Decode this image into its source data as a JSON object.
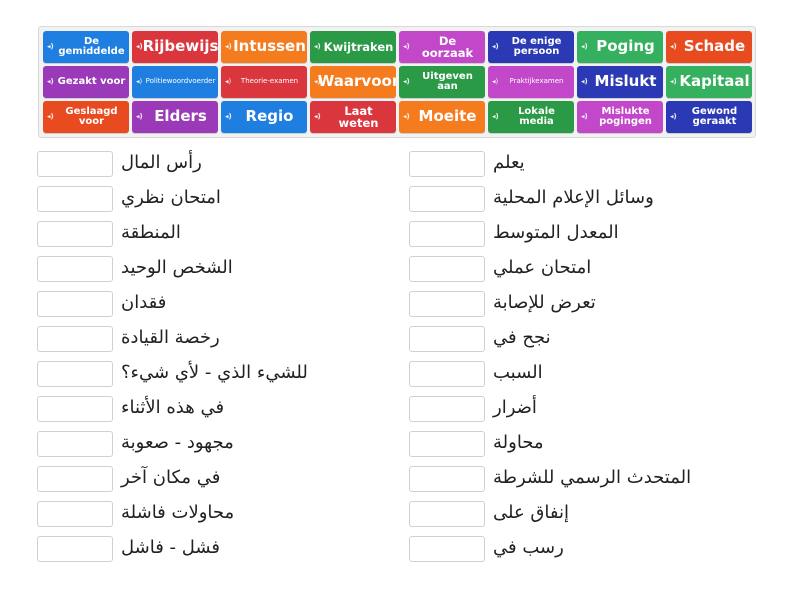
{
  "tiles": [
    {
      "label": "De gemiddelde",
      "color": "#1f7fe0",
      "size": "sz-s"
    },
    {
      "label": "Rijbewijs",
      "color": "#d9363e",
      "size": "sz-l"
    },
    {
      "label": "Intussen",
      "color": "#f47c1f",
      "size": "sz-l"
    },
    {
      "label": "Kwijtraken",
      "color": "#2b9a47",
      "size": "sz-m"
    },
    {
      "label": "De oorzaak",
      "color": "#c348c9",
      "size": "sz-m"
    },
    {
      "label": "De enige persoon",
      "color": "#2b3ab4",
      "size": "sz-s"
    },
    {
      "label": "Poging",
      "color": "#34b05e",
      "size": "sz-l"
    },
    {
      "label": "Schade",
      "color": "#e84b1f",
      "size": "sz-l"
    },
    {
      "label": "Gezakt voor",
      "color": "#9b3ab8",
      "size": "sz-s"
    },
    {
      "label": "Politiewoordvoerder",
      "color": "#1f7fe0",
      "size": "sz-xs"
    },
    {
      "label": "Theorie-examen",
      "color": "#d9363e",
      "size": "sz-xs"
    },
    {
      "label": "Waarvoor",
      "color": "#f47c1f",
      "size": "sz-l"
    },
    {
      "label": "Uitgeven aan",
      "color": "#2b9a47",
      "size": "sz-s"
    },
    {
      "label": "Praktijkexamen",
      "color": "#c348c9",
      "size": "sz-xs"
    },
    {
      "label": "Mislukt",
      "color": "#2b3ab4",
      "size": "sz-l"
    },
    {
      "label": "Kapitaal",
      "color": "#34b05e",
      "size": "sz-l"
    },
    {
      "label": "Geslaagd voor",
      "color": "#e84b1f",
      "size": "sz-s"
    },
    {
      "label": "Elders",
      "color": "#9b3ab8",
      "size": "sz-l"
    },
    {
      "label": "Regio",
      "color": "#1f7fe0",
      "size": "sz-l"
    },
    {
      "label": "Laat weten",
      "color": "#d9363e",
      "size": "sz-m"
    },
    {
      "label": "Moeite",
      "color": "#f47c1f",
      "size": "sz-l"
    },
    {
      "label": "Lokale media",
      "color": "#2b9a47",
      "size": "sz-s"
    },
    {
      "label": "Mislukte pogingen",
      "color": "#c348c9",
      "size": "sz-s"
    },
    {
      "label": "Gewond geraakt",
      "color": "#2b3ab4",
      "size": "sz-s"
    }
  ],
  "left_column": [
    "رأس المال",
    "امتحان نظري",
    "المنطقة",
    "الشخص الوحيد",
    "فقدان",
    "رخصة القيادة",
    "للشيء الذي - لأي شيء؟",
    "في هذه الأثناء",
    "مجهود - صعوبة",
    "في مكان آخر",
    "محاولات فاشلة",
    "فشل - فاشل"
  ],
  "right_column": [
    "يعلم",
    "وسائل الإعلام المحلية",
    "المعدل المتوسط",
    "امتحان عملي",
    "تعرض للإصابة",
    "نجح في",
    "السبب",
    "أضرار",
    "محاولة",
    "المتحدث الرسمي للشرطة",
    "إنفاق على",
    "رسب في"
  ],
  "icons": {
    "tile_icon": "speaker-icon",
    "tile_glyph": "🔊"
  }
}
